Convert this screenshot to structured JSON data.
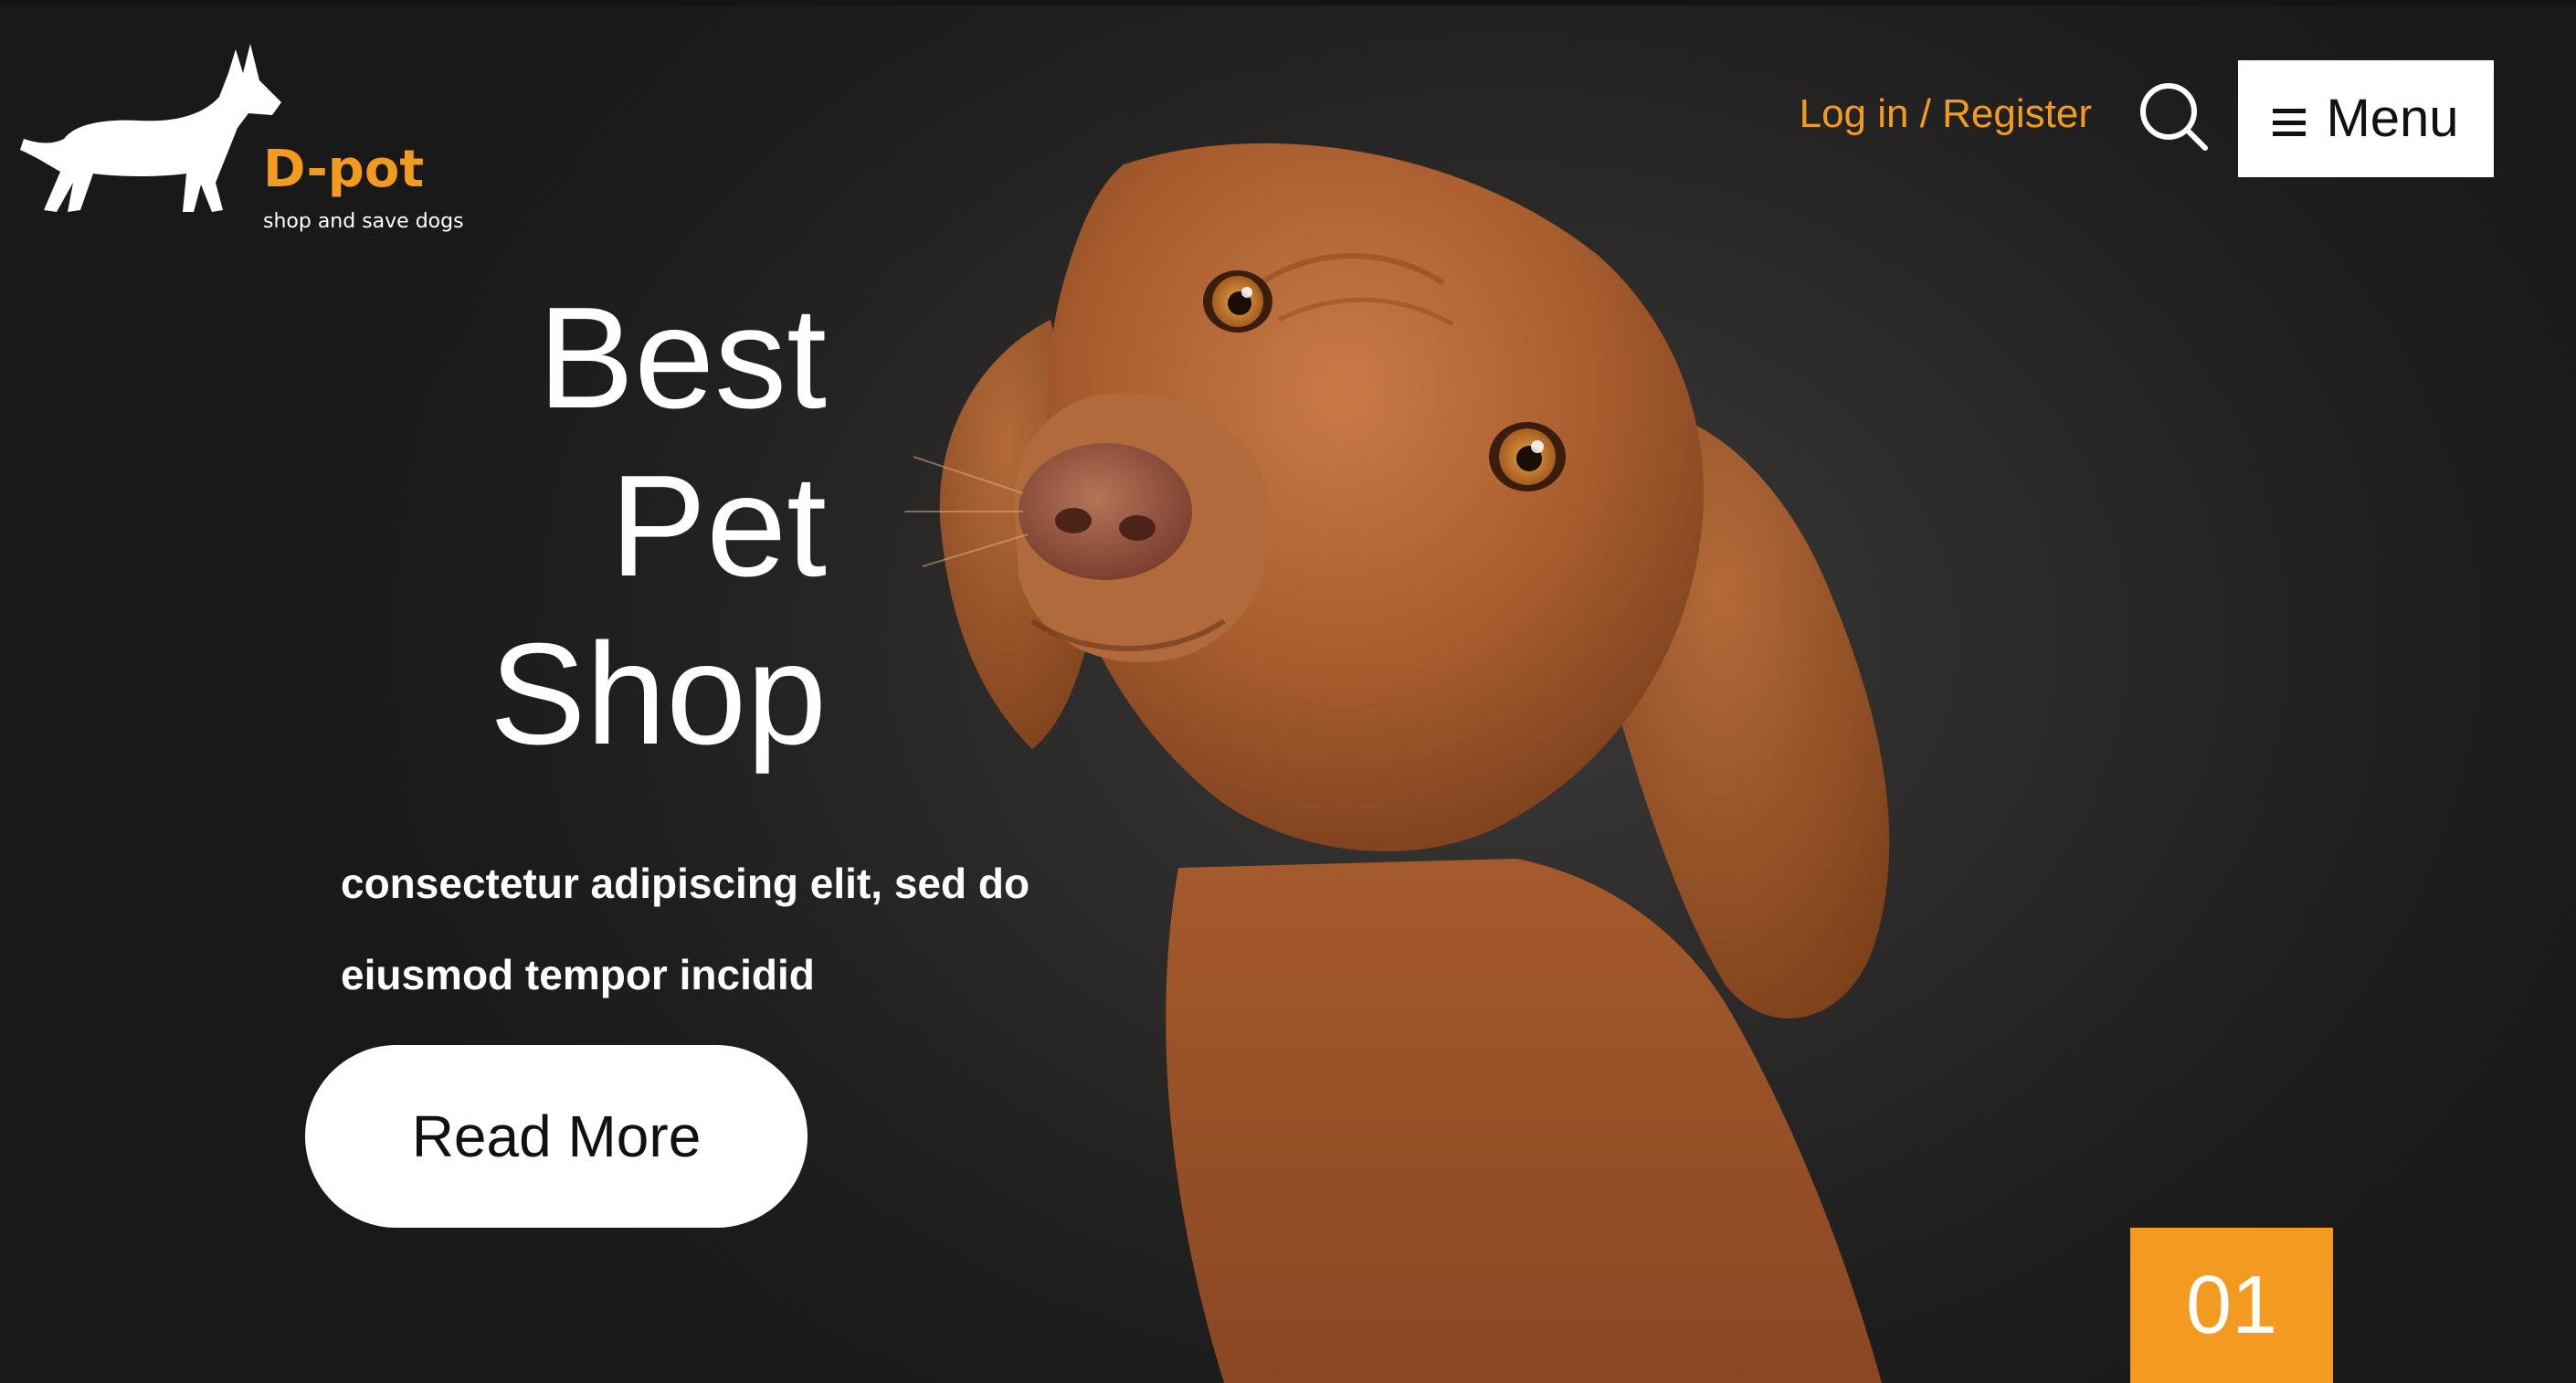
{
  "brand": {
    "name": "D-pot",
    "tagline": "shop and save dogs",
    "accent_color": "#f39a21",
    "logo_icon": "dog-silhouette-icon"
  },
  "header": {
    "login_label": "Log in / Register",
    "search_icon": "search-icon",
    "menu_icon": "hamburger-menu-icon",
    "menu_label": "Menu"
  },
  "hero": {
    "headline": [
      "Best",
      "Pet",
      "Shop"
    ],
    "subtext": [
      "consectetur adipiscing elit, sed do",
      "eiusmod tempor incidid"
    ],
    "cta_label": "Read More",
    "image": "dog-portrait",
    "slide_number": "01"
  }
}
